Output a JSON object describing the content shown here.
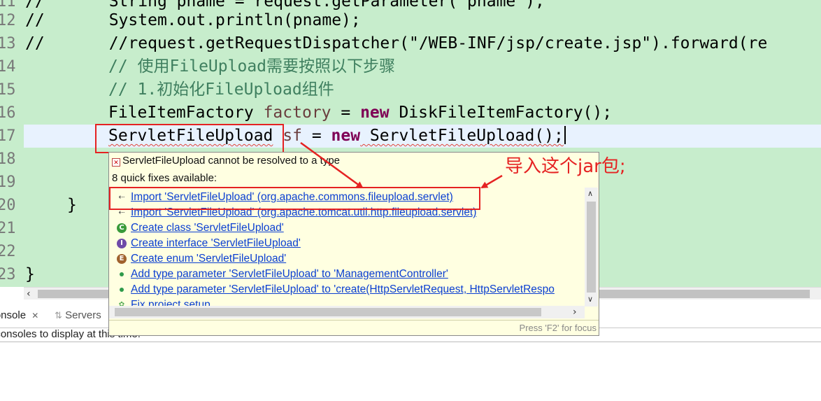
{
  "editor": {
    "lines": [
      {
        "num": "11",
        "prefix": "//",
        "code": "String pname = request.getParameter(\"pname\");"
      },
      {
        "num": "12",
        "prefix": "//",
        "code": "System.out.println(pname);"
      },
      {
        "num": "13",
        "prefix": "//",
        "code": "//request.getRequestDispatcher(\"/WEB-INF/jsp/create.jsp\").forward(re"
      },
      {
        "num": "14",
        "code": "// 使用FileUpload需要按照以下步骤"
      },
      {
        "num": "15",
        "code": "// 1.初始化FileUpload组件"
      },
      {
        "num": "16",
        "type": "FileItemFactory",
        "var": "factory",
        "op": " = ",
        "kw": "new",
        "ctor": " DiskFileItemFactory();"
      },
      {
        "num": "17",
        "type": "ServletFileUpload",
        "var": "sf",
        "op": " = ",
        "kw": "new",
        "ctor": " ServletFileUpload();"
      },
      {
        "num": "18"
      },
      {
        "num": "19"
      },
      {
        "num": "20",
        "code": "}"
      },
      {
        "num": "21"
      },
      {
        "num": "22"
      },
      {
        "num": "23",
        "code": "}"
      }
    ]
  },
  "panel": {
    "tabs": [
      {
        "label": "Console",
        "close": "✕"
      },
      {
        "label": "Servers"
      }
    ],
    "message": "No consoles to display at this time."
  },
  "quickfix": {
    "error": "ServletFileUpload cannot be resolved to a type",
    "count_label": "8 quick fixes available:",
    "items": [
      {
        "icon": "import-icon",
        "label": "Import 'ServletFileUpload' (org.apache.commons.fileupload.servlet)"
      },
      {
        "icon": "import-icon",
        "label": "Import 'ServletFileUpload' (org.apache.tomcat.util.http.fileupload.servlet)"
      },
      {
        "icon": "class-icon",
        "glyph": "C",
        "label": "Create class 'ServletFileUpload'"
      },
      {
        "icon": "interface-icon",
        "glyph": "I",
        "label": "Create interface 'ServletFileUpload'"
      },
      {
        "icon": "enum-icon",
        "glyph": "E",
        "label": "Create enum 'ServletFileUpload'"
      },
      {
        "icon": "type-parameter-icon",
        "label": "Add type parameter 'ServletFileUpload' to 'ManagementController'"
      },
      {
        "icon": "type-parameter-icon",
        "label": "Add type parameter 'ServletFileUpload' to 'create(HttpServletRequest, HttpServletRespo"
      },
      {
        "icon": "fix-project-icon",
        "label": "Fix project setup..."
      }
    ],
    "footer": "Press 'F2' for focus"
  },
  "annotation": {
    "text": "导入这个jar包;",
    "color": "#e52222"
  },
  "colors": {
    "editor_bg": "#c7edcc",
    "current_line": "#e8f2fe",
    "popup_bg": "#ffffe1",
    "link": "#0b3fd1",
    "keyword": "#7f0055",
    "comment": "#3f7f5f"
  }
}
